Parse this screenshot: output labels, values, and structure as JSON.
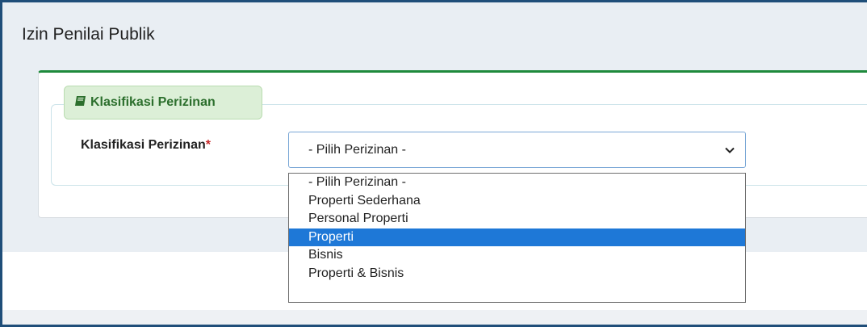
{
  "page": {
    "title": "Izin Penilai Publik"
  },
  "section": {
    "legend": "Klasifikasi Perizinan",
    "legend_icon": "book-icon"
  },
  "form": {
    "label": "Klasifikasi Perizinan",
    "required_mark": "*",
    "select_value": "- Pilih Perizinan -",
    "options": [
      "- Pilih Perizinan -",
      "Properti Sederhana",
      "Personal Properti",
      "Properti",
      "Bisnis",
      "Properti & Bisnis"
    ],
    "highlighted_option": "Properti"
  },
  "colors": {
    "accent_green": "#1e8a3c",
    "highlight_blue": "#1e78d7",
    "frame_border": "#1f4e79"
  }
}
